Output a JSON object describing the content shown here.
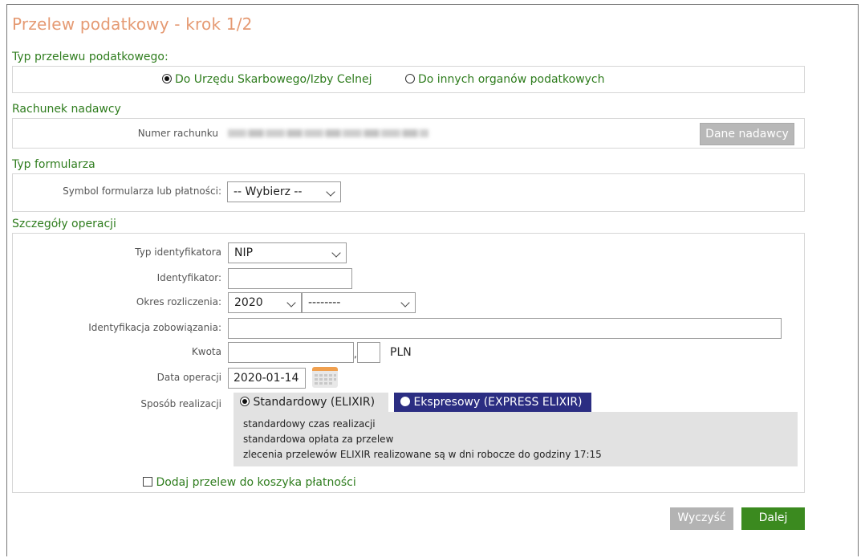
{
  "title": "Przelew podatkowy - krok 1/2",
  "transfer_type": {
    "label": "Typ przelewu podatkowego:",
    "options": [
      {
        "label": "Do Urzędu Skarbowego/Izby Celnej",
        "selected": true
      },
      {
        "label": "Do innych organów podatkowych",
        "selected": false
      }
    ]
  },
  "sender_account": {
    "label": "Rachunek nadawcy",
    "account_number_label": "Numer rachunku",
    "sender_data_button": "Dane nadawcy"
  },
  "form_type": {
    "label": "Typ formularza",
    "symbol_label": "Symbol formularza lub płatności:",
    "symbol_value": "-- Wybierz --"
  },
  "details": {
    "label": "Szczegóły operacji",
    "identifier_type_label": "Typ identyfikatora",
    "identifier_type_value": "NIP",
    "identifier_label": "Identyfikator:",
    "identifier_value": "",
    "period_label": "Okres rozliczenia:",
    "period_year": "2020",
    "period_sub": "--------",
    "obligation_label": "Identyfikacja zobowiązania:",
    "obligation_value": "",
    "amount_label": "Kwota",
    "amount_separator": ",",
    "currency": "PLN",
    "date_label": "Data operacji",
    "date_value": "2020-01-14",
    "method_label": "Sposób realizacji",
    "method_standard": "Standardowy (ELIXIR)",
    "method_express": "Ekspresowy (EXPRESS ELIXIR)",
    "info_lines": [
      "standardowy czas realizacji",
      "standardowa opłata za przelew",
      "zlecenia przelewów ELIXIR realizowane są w dni robocze do godziny 17:15"
    ],
    "add_to_basket": "Dodaj przelew do koszyka płatności"
  },
  "buttons": {
    "clear": "Wyczyść",
    "next": "Dalej"
  },
  "colors": {
    "title": "#e59a73",
    "section": "#2f7d1e",
    "express_bg": "#2b2d82",
    "next_bg": "#3b8a1f",
    "clear_bg": "#b3b3b3"
  }
}
